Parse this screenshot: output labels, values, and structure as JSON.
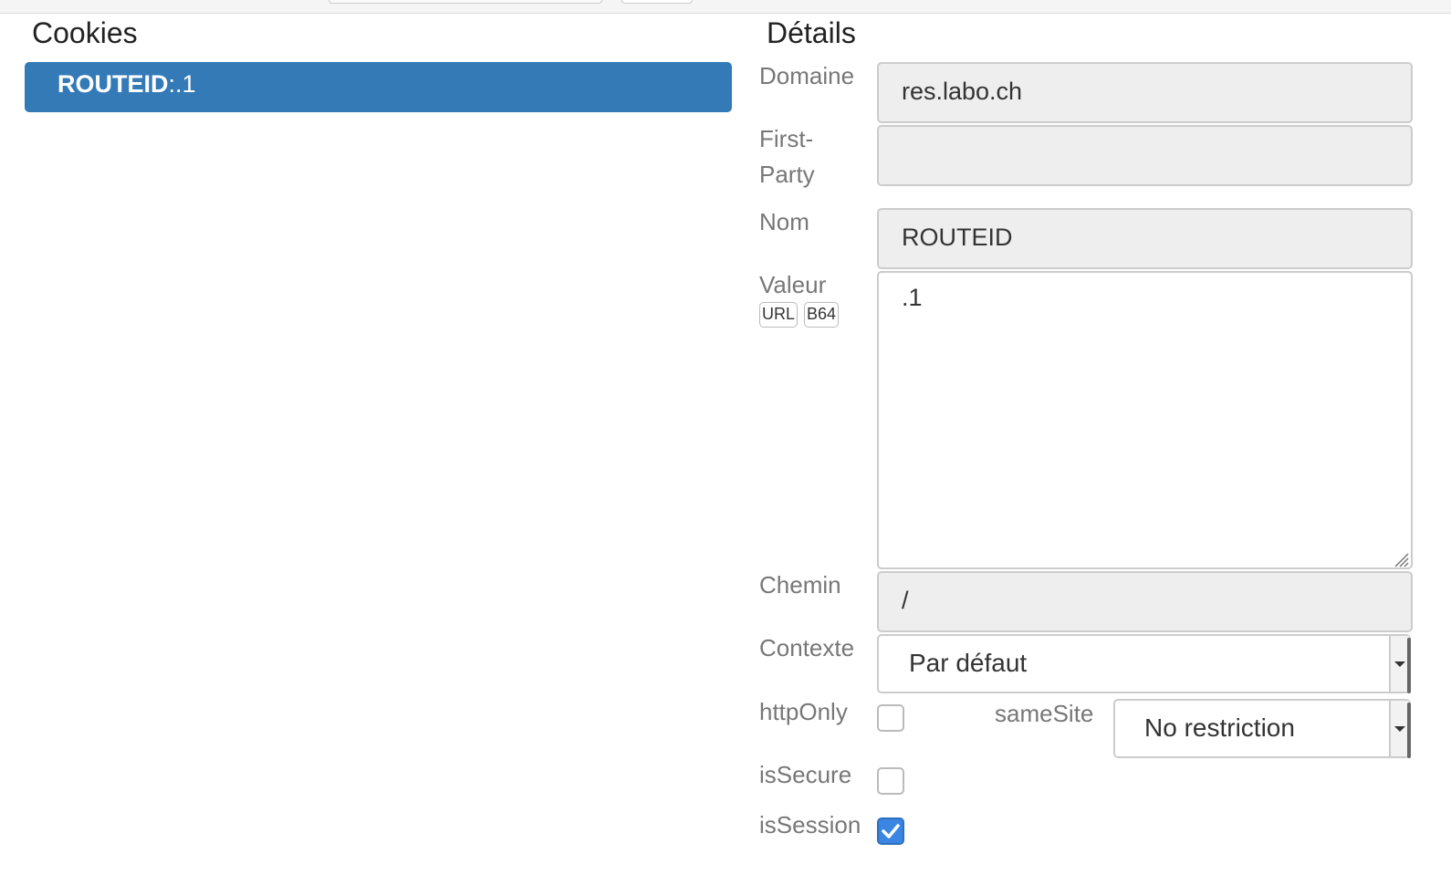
{
  "cookies_panel": {
    "title": "Cookies",
    "items": [
      {
        "name": "ROUTEID",
        "separator": ":",
        "value": ".1"
      }
    ]
  },
  "details_panel": {
    "title": "Détails",
    "domain": {
      "label": "Domaine",
      "value": "res.labo.ch"
    },
    "first_party": {
      "label_line1": "First-",
      "label_line2": "Party",
      "value": ""
    },
    "name": {
      "label": "Nom",
      "value": "ROUTEID"
    },
    "value": {
      "label": "Valeur",
      "value": ".1",
      "url_button": "URL",
      "b64_button": "B64"
    },
    "path": {
      "label": "Chemin",
      "value": "/"
    },
    "context": {
      "label": "Contexte",
      "selected": "Par défaut"
    },
    "http_only": {
      "label": "httpOnly",
      "checked": false
    },
    "same_site": {
      "label": "sameSite",
      "selected": "No restriction"
    },
    "is_secure": {
      "label": "isSecure",
      "checked": false
    },
    "is_session": {
      "label": "isSession",
      "checked": true
    }
  },
  "colors": {
    "selected_item_bg": "#337ab7",
    "checkbox_checked": "#3c86e3",
    "label_text": "#777777"
  }
}
